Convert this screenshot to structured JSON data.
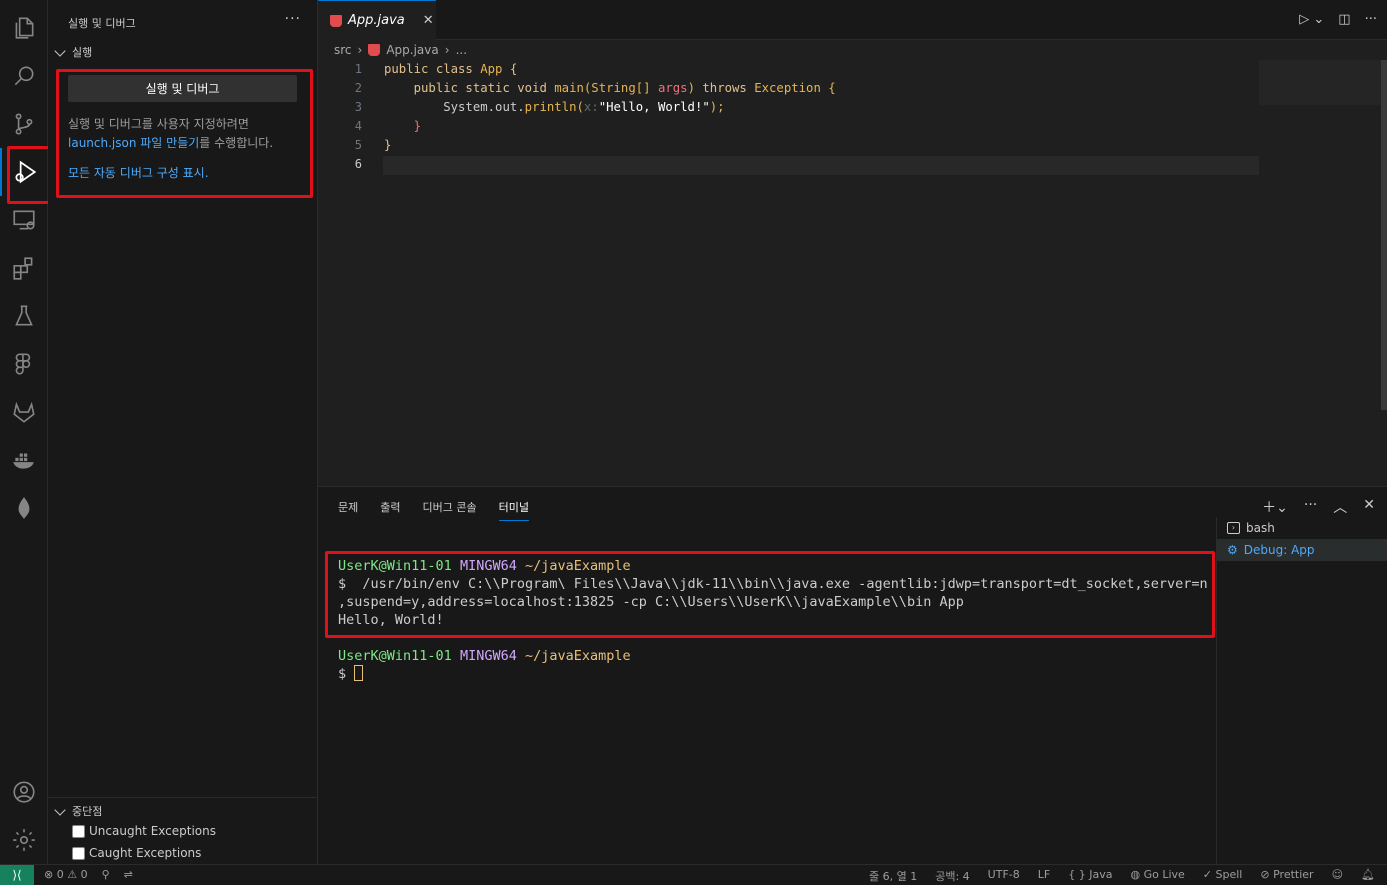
{
  "sidebar": {
    "title": "실행 및 디버그",
    "more": "···",
    "run_section": "실행",
    "run_button": "실행 및 디버그",
    "desc_1": "실행 및 디버그를 사용자 지정하려면",
    "link_launch": "launch.json 파일 만들기",
    "desc_2": "를 수행합니다.",
    "link_auto": "모든 자동 디버그 구성 표시.",
    "breakpoints_section": "중단점",
    "breakpoints": [
      "Uncaught Exceptions",
      "Caught Exceptions"
    ]
  },
  "editor": {
    "tab_label": "App.java",
    "tab_close": "✕",
    "breadcrumb": {
      "folder": "src",
      "file": "App.java",
      "tail": "..."
    },
    "line_numbers": [
      "1",
      "2",
      "3",
      "4",
      "5",
      "6"
    ],
    "code": {
      "l1_a": "public class ",
      "l1_b": "App",
      "l1_c": " {",
      "l2_a": "    public static void ",
      "l2_b": "main",
      "l2_c": "(String[] ",
      "l2_d": "args",
      "l2_e": ") ",
      "l2_f": "throws",
      "l2_g": " Exception {",
      "l3_a": "        System.out.",
      "l3_b": "println",
      "l3_c": "(",
      "l3_hint": "x:",
      "l3_d": "\"Hello, World!\"",
      "l3_e": ");",
      "l4": "    }",
      "l5": "}"
    }
  },
  "panel": {
    "tabs": [
      "문제",
      "출력",
      "디버그 콘솔",
      "터미널"
    ],
    "active_tab": "터미널",
    "terminal": {
      "user": "UserK@Win11-01",
      "shell": "MINGW64",
      "cwd": "~/javaExample",
      "prompt": "$",
      "cmd_1": "  /usr/bin/env C:\\\\Program\\ Files\\\\Java\\\\jdk-11\\\\bin\\\\java.exe -agentlib:jdwp=transport=dt_socket,server=n",
      "cmd_2": ",suspend=y,address=localhost:13825 -cp C:\\\\Users\\\\UserK\\\\javaExample\\\\bin App",
      "output": "Hello, World!"
    },
    "terminal_list": [
      "bash",
      "Debug: App"
    ]
  },
  "status": {
    "errors": "0",
    "warnings": "0",
    "position": "줄 6, 열 1",
    "spaces": "공백: 4",
    "encoding": "UTF-8",
    "eol": "LF",
    "language": "Java",
    "golive": "Go Live",
    "spell": "Spell",
    "prettier": "Prettier"
  },
  "colors": {
    "accent": "#0078d4",
    "highlight_box": "#e0101a",
    "remote": "#16825d"
  }
}
